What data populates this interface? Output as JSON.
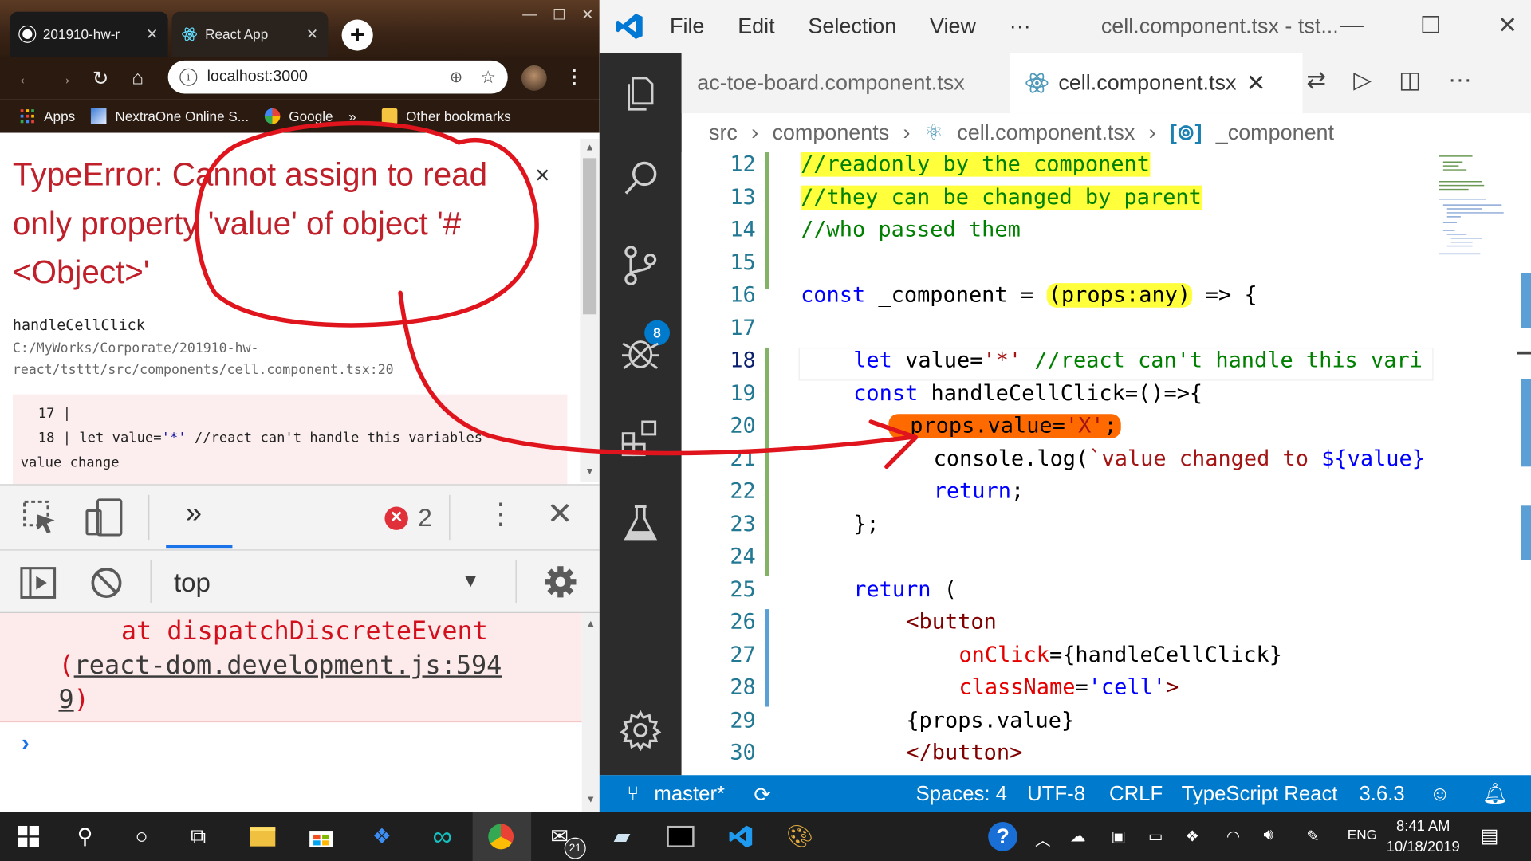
{
  "chrome": {
    "tabs": [
      {
        "title": "201910-hw-r",
        "close": "✕"
      },
      {
        "title": "React App",
        "close": "✕"
      }
    ],
    "new_tab": "+",
    "window_controls": [
      "—",
      "☐",
      "✕"
    ],
    "url": "localhost:3000",
    "bookmarks": [
      "Apps",
      "NextraOne Online S...",
      "Google",
      "»",
      "Other bookmarks"
    ],
    "error": {
      "title": "TypeError: Cannot assign to read only property 'value' of object '#<Object>'",
      "close": "×",
      "function": "handleCellClick",
      "path": "C:/MyWorks/Corporate/201910-hw-react/tsttt/src/components/cell.component.tsx:20",
      "snippet": {
        "line17": "17 |",
        "line18_pre": "18 |    let value=",
        "line18_str": "'*'",
        "line18_post": " //react can't handle this variables",
        "line18_wrap": "value change"
      }
    },
    "devtools": {
      "error_count": "2",
      "context": "top",
      "console_error": {
        "line1": "at dispatchDiscreteEvent",
        "line2_open": "(",
        "line2_link": "react-dom.development.js:594",
        "line3_link": "9",
        "line3_close": ")"
      },
      "prompt": "›"
    }
  },
  "vscode": {
    "menu": [
      "File",
      "Edit",
      "Selection",
      "View",
      "···"
    ],
    "window_title": "cell.component.tsx - tst...",
    "window_controls": [
      "—",
      "☐",
      "✕"
    ],
    "tabs": [
      {
        "label": "ac-toe-board.component.tsx"
      },
      {
        "label": "cell.component.tsx",
        "close": "✕"
      }
    ],
    "breadcrumb": [
      "src",
      "components",
      "cell.component.tsx",
      "_component"
    ],
    "breadcrumb_sep": "›",
    "scm_badge": "8",
    "code": {
      "lines": [
        "12",
        "13",
        "14",
        "15",
        "16",
        "17",
        "18",
        "19",
        "20",
        "21",
        "22",
        "23",
        "24",
        "25",
        "26",
        "27",
        "28",
        "29",
        "30"
      ],
      "c12": "//readonly by the component",
      "c13": "//they can be changed by parent",
      "c14": "//who passed them",
      "c16a": "const",
      "c16b": " _component = ",
      "c16c": "(props:any)",
      "c16d": " => {",
      "c18a": "let",
      "c18b": " value=",
      "c18c": "'*'",
      "c18d": " //react can't handle this vari",
      "c19a": "const",
      "c19b": " handleCellClick=()=>{",
      "c20a": "props.value=",
      "c20b": "'X'",
      "c20c": ";",
      "c21a": "console.log(",
      "c21b": "`value changed to ",
      "c21c": "${value}",
      "c22a": "return",
      "c22b": ";",
      "c23": "};",
      "c25a": "return",
      "c25b": " (",
      "c26a": "<",
      "c26b": "button",
      "c27a": "onClick",
      "c27b": "={handleCellClick}",
      "c28a": "className",
      "c28b": "=",
      "c28c": "'cell'",
      "c28d": ">",
      "c29": "{props.value}",
      "c30a": "</",
      "c30b": "button",
      "c30c": ">"
    },
    "status": {
      "branch": "master*",
      "spaces": "Spaces: 4",
      "encoding": "UTF-8",
      "eol": "CRLF",
      "language": "TypeScript React",
      "version": "3.6.3"
    }
  },
  "taskbar": {
    "mail_badge": "21",
    "lang": "ENG",
    "time": "8:41 AM",
    "date": "10/18/2019"
  },
  "colors": {
    "error_red": "#c0202a",
    "vscode_blue": "#007acc",
    "highlight_yellow": "#ffff3c",
    "highlight_orange": "#ff6a00",
    "annotation_red": "#e0141c"
  }
}
